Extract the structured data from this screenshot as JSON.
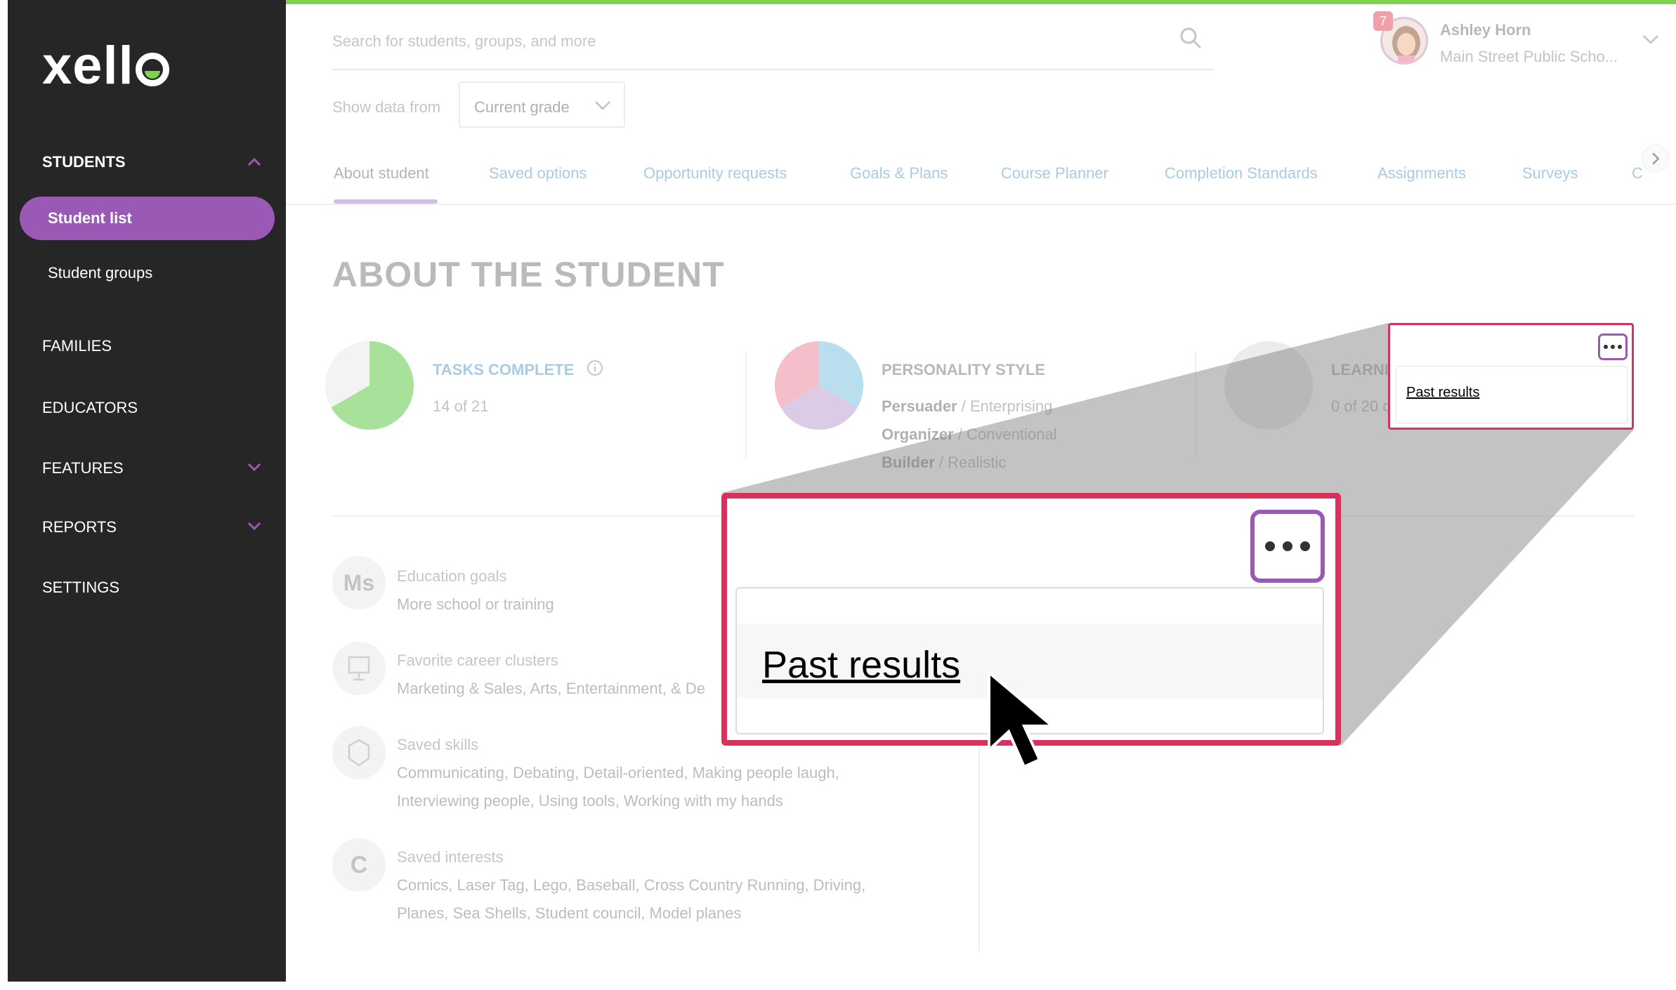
{
  "brand": {
    "logo_text": "xell",
    "accent": "#9b59b6",
    "green": "#7ed24f",
    "callout": "#d8315b"
  },
  "sidebar": {
    "students_label": "STUDENTS",
    "student_list": "Student list",
    "student_groups": "Student groups",
    "families": "FAMILIES",
    "educators": "EDUCATORS",
    "features": "FEATURES",
    "reports": "REPORTS",
    "settings": "SETTINGS"
  },
  "header": {
    "search_placeholder": "Search for students, groups, and more",
    "notification_count": "7",
    "user_name": "Ashley Horn",
    "user_school": "Main Street Public Scho..."
  },
  "filter": {
    "label": "Show data from",
    "value": "Current grade"
  },
  "tabs": [
    {
      "label": "About student"
    },
    {
      "label": "Saved options"
    },
    {
      "label": "Opportunity requests"
    },
    {
      "label": "Goals & Plans"
    },
    {
      "label": "Course Planner"
    },
    {
      "label": "Completion Standards"
    },
    {
      "label": "Assignments"
    },
    {
      "label": "Surveys"
    },
    {
      "label": "C"
    }
  ],
  "page_title": "ABOUT THE STUDENT",
  "stats": {
    "tasks": {
      "title": "TASKS COMPLETE",
      "value": "14 of 21",
      "completed": 14,
      "total": 21
    },
    "personality": {
      "title": "PERSONALITY STYLE",
      "lines": [
        {
          "bold": "Persuader",
          "rest": " / Enterprising"
        },
        {
          "bold": "Organizer",
          "rest": " / Conventional"
        },
        {
          "bold": "Builder",
          "rest": " / Realistic"
        }
      ]
    },
    "learning": {
      "title": "LEARNI",
      "value": "0 of 20 c"
    }
  },
  "info": [
    {
      "icon": "Ms",
      "label": "Education goals",
      "text": [
        "More school or training"
      ]
    },
    {
      "icon": "",
      "label": "Favorite career clusters",
      "text": [
        "Marketing & Sales, Arts, Entertainment, & De"
      ]
    },
    {
      "icon": "",
      "label": "Saved skills",
      "text": [
        "Communicating, Debating, Detail-oriented, Making people laugh,",
        "Interviewing people, Using tools, Working with my hands"
      ]
    },
    {
      "icon": "C",
      "label": "Saved interests",
      "text": [
        "Comics, Laser Tag, Lego, Baseball, Cross Country Running, Driving,",
        "Planes, Sea Shells, Student council, Model planes"
      ]
    }
  ],
  "callout": {
    "menu_item": "Past results"
  }
}
